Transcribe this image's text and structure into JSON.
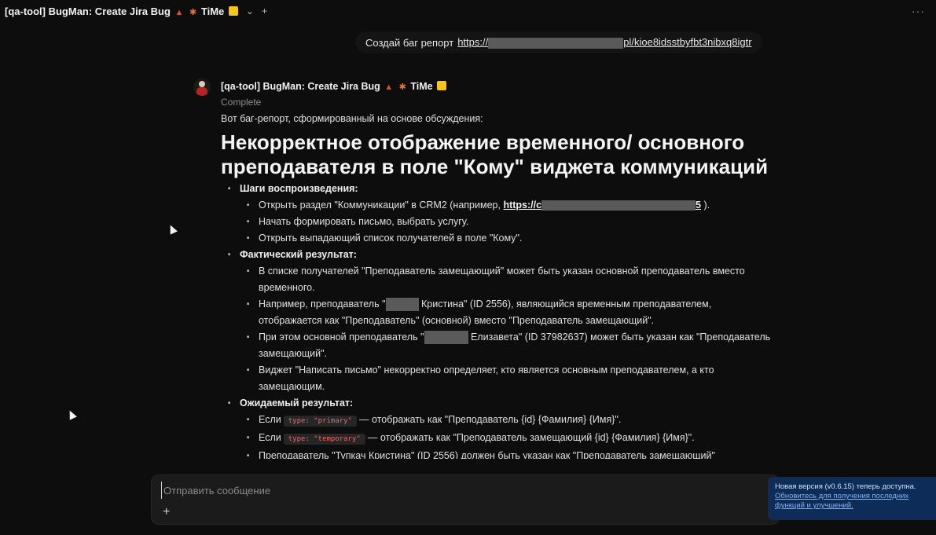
{
  "topbar": {
    "title": "[qa-tool] BugMan: Create Jira Bug",
    "title_suffix": "TiMe",
    "icons": [
      "ant-emoji",
      "bug-emoji",
      "yellow-square-emoji"
    ],
    "chevron": "⌄",
    "add": "+",
    "more": "···"
  },
  "user_message": {
    "text": "Создай баг репорт",
    "link_visible_part": "https://",
    "link_tail": "pl/kioe8idsstbyfbt3nibxq8igtr"
  },
  "assistant": {
    "name": "[qa-tool] BugMan: Create Jira Bug",
    "name_suffix": "TiMe",
    "status": "Complete",
    "intro": "Вот баг-репорт, сформированный на основе обсуждения:",
    "title": "Некорректное отображение временного/ основного преподавателя в поле \"Кому\" виджета коммуникаций",
    "steps": {
      "label": "Шаги воспроизведения:",
      "item1_pre": "Открыть раздел \"Коммуникации\" в CRM2 (например,",
      "item1_link_start": "https://c",
      "item1_link_end": "5",
      "item1_post": ").",
      "item2": "Начать формировать письмо, выбрать услугу.",
      "item3": "Открыть выпадающий список получателей в поле \"Кому\"."
    },
    "actual": {
      "label": "Фактический результат:",
      "item1": "В списке получателей \"Преподаватель замещающий\" может быть указан основной преподаватель вместо временного.",
      "item2_pre": "Например, преподаватель \"",
      "item2_post": " Кристина\" (ID 2556), являющийся временным преподавателем, отображается как \"Преподаватель\" (основной) вместо \"Преподаватель замещающий\".",
      "item3_pre": "При этом основной преподаватель \"",
      "item3_post": " Елизавета\" (ID 37982637) может быть указан как \"Преподаватель замещающий\".",
      "item4": "Виджет \"Написать письмо\" некорректно определяет, кто является основным преподавателем, а кто замещающим."
    },
    "expected": {
      "label": "Ожидаемый результат:",
      "item1_pre": "Если",
      "item1_code": "type: \"primary\"",
      "item1_post": "— отображать как \"Преподаватель {id} {Фамилия} {Имя}\".",
      "item2_pre": "Если",
      "item2_code": "type: \"temporary\"",
      "item2_post": "— отображать как \"Преподаватель замещающий {id} {Фамилия} {Имя}\".",
      "item3_truncated": "Преподаватель \"Тупкач Кристина\" (ID 2556) должен быть указан как \"Преподаватель замещающий\""
    }
  },
  "composer": {
    "placeholder": "Отправить сообщение",
    "attach": "+"
  },
  "toast": {
    "title": "Новая версия (v0.6.15) теперь доступна.",
    "link": "Обновитесь для получения последних функций и улучшений."
  },
  "colors": {
    "background": "#0d0d0d",
    "toast_bg": "#0d2c57",
    "code_text": "#e46a6a"
  }
}
